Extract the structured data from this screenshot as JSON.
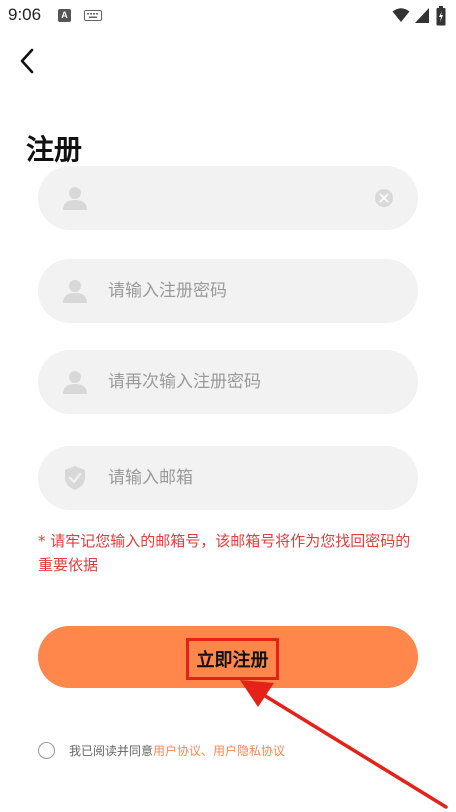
{
  "status_bar": {
    "time": "9:06",
    "a_badge": "A"
  },
  "page": {
    "title": "注册"
  },
  "form": {
    "username": {
      "value": "",
      "placeholder": ""
    },
    "password": {
      "placeholder": "请输入注册密码"
    },
    "password_confirm": {
      "placeholder": "请再次输入注册密码"
    },
    "email": {
      "placeholder": "请输入邮箱"
    }
  },
  "notice": "* 请牢记您输入的邮箱号，该邮箱号将作为您找回密码的重要依据",
  "register_button": {
    "label": "立即注册"
  },
  "agreement": {
    "prefix": "我已阅读并同意 ",
    "user_agreement": "用户协议",
    "separator": "、",
    "privacy_agreement": "用户隐私协议"
  },
  "colors": {
    "accent": "#ff874b",
    "warning": "#e63c3c",
    "field_bg": "#f2f2f2",
    "highlight": "#e62117"
  },
  "icons": [
    "wifi-icon",
    "signal-icon",
    "battery-icon",
    "back-arrow-icon",
    "user-icon",
    "clear-icon",
    "shield-icon"
  ]
}
